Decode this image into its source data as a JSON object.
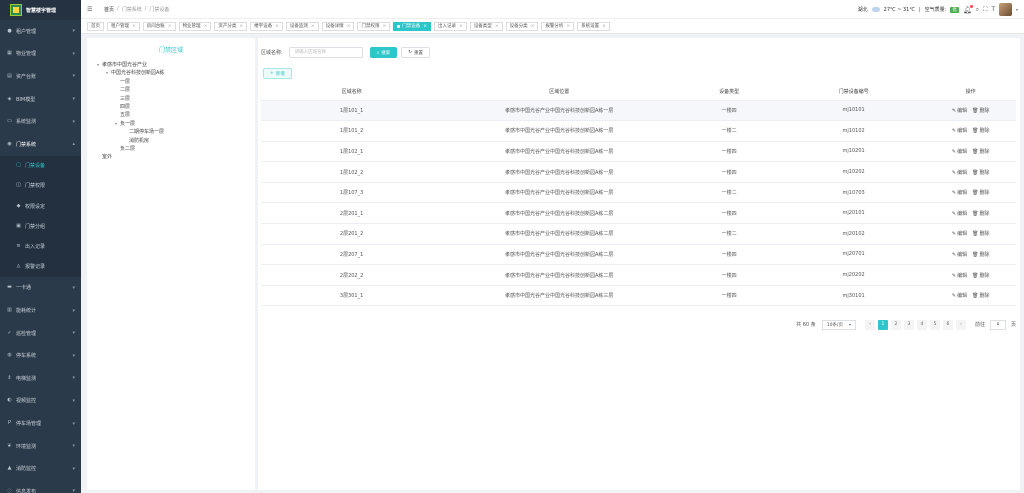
{
  "app": {
    "title": "智慧楼宇管理"
  },
  "sidebar": {
    "items": [
      {
        "label": "租户管理",
        "icon": "user-icon"
      },
      {
        "label": "物业管理",
        "icon": "building-icon"
      },
      {
        "label": "资产台账",
        "icon": "grid-icon"
      },
      {
        "label": "BIM模型",
        "icon": "cube-icon"
      },
      {
        "label": "系统监测",
        "icon": "monitor-icon"
      },
      {
        "label": "门禁系统",
        "icon": "lock-icon",
        "open": true
      }
    ],
    "sub_items": [
      {
        "label": "门禁设备",
        "icon": "door-icon",
        "active": true
      },
      {
        "label": "门禁权限",
        "icon": "key-icon"
      },
      {
        "label": "权限设定",
        "icon": "shield-icon"
      },
      {
        "label": "门禁分组",
        "icon": "folder-icon"
      },
      {
        "label": "出入记录",
        "icon": "list-icon"
      },
      {
        "label": "报警记录",
        "icon": "alarm-icon"
      }
    ],
    "items_after": [
      {
        "label": "一卡通",
        "icon": "card-icon"
      },
      {
        "label": "能耗统计",
        "icon": "chart-icon"
      },
      {
        "label": "巡检管理",
        "icon": "check-icon"
      },
      {
        "label": "停车系统",
        "icon": "car-icon"
      },
      {
        "label": "电梯监测",
        "icon": "elevator-icon"
      },
      {
        "label": "视频监控",
        "icon": "camera-icon"
      },
      {
        "label": "停车场管理",
        "icon": "parking-icon"
      },
      {
        "label": "环境监测",
        "icon": "leaf-icon"
      },
      {
        "label": "消防监控",
        "icon": "fire-icon"
      },
      {
        "label": "信息发布",
        "icon": "message-icon"
      }
    ]
  },
  "header": {
    "breadcrumb": [
      "首页",
      "门禁系统",
      "门禁设备"
    ],
    "location": "湖北",
    "temperature": "27℃ ~ 31℃",
    "air_label": "空气质量:",
    "air_value": "优"
  },
  "tags": [
    {
      "label": "首页"
    },
    {
      "label": "租户管理"
    },
    {
      "label": "房间台账"
    },
    {
      "label": "物业管理"
    },
    {
      "label": "资产分类"
    },
    {
      "label": "楼宇设备"
    },
    {
      "label": "设备监测"
    },
    {
      "label": "设备详情"
    },
    {
      "label": "门禁权限"
    },
    {
      "label": "门禁设备",
      "active": true
    },
    {
      "label": "出入记录"
    },
    {
      "label": "设备类型"
    },
    {
      "label": "设备分类"
    },
    {
      "label": "报警分析"
    },
    {
      "label": "系统设置"
    }
  ],
  "tree": {
    "title": "门禁区域",
    "nodes": [
      {
        "label": "孝感市中国光谷产业",
        "level": 0,
        "toggle": "▾"
      },
      {
        "label": "中国光谷科技创新园A栋",
        "level": 1,
        "toggle": "▾"
      },
      {
        "label": "一层",
        "level": 2,
        "toggle": ""
      },
      {
        "label": "二层",
        "level": 2,
        "toggle": ""
      },
      {
        "label": "三层",
        "level": 2,
        "toggle": ""
      },
      {
        "label": "四层",
        "level": 2,
        "toggle": ""
      },
      {
        "label": "五层",
        "level": 2,
        "toggle": ""
      },
      {
        "label": "负一层",
        "level": 2,
        "toggle": "▾"
      },
      {
        "label": "二期停车场一层",
        "level": 3,
        "toggle": ""
      },
      {
        "label": "消防机房",
        "level": 3,
        "toggle": ""
      },
      {
        "label": "负二层",
        "level": 2,
        "toggle": ""
      },
      {
        "label": "室外",
        "level": 0,
        "toggle": ""
      }
    ]
  },
  "search": {
    "label": "区域名称:",
    "placeholder": "请输入区域名称",
    "search_label": "搜索",
    "reset_label": "重置",
    "add_label": "新增"
  },
  "table": {
    "columns": [
      "区域名称",
      "区域位置",
      "设备类型",
      "门禁设备编号",
      "操作"
    ],
    "edit_label": "编辑",
    "delete_label": "删除",
    "rows": [
      [
        "1层101_1",
        "孝感市中国光谷产业中国光谷科技创新园A栋一层",
        "一楼四",
        "mj10101"
      ],
      [
        "1层101_2",
        "孝感市中国光谷产业中国光谷科技创新园A栋一层",
        "一楼二",
        "mj10102"
      ],
      [
        "1层102_1",
        "孝感市中国光谷产业中国光谷科技创新园A栋一层",
        "一楼四",
        "mj10201"
      ],
      [
        "1层102_2",
        "孝感市中国光谷产业中国光谷科技创新园A栋一层",
        "一楼四",
        "mj10202"
      ],
      [
        "1层107_3",
        "孝感市中国光谷产业中国光谷科技创新园A栋一层",
        "一楼二",
        "mj10703"
      ],
      [
        "2层201_1",
        "孝感市中国光谷产业中国光谷科技创新园A栋二层",
        "一楼四",
        "mj20101"
      ],
      [
        "2层201_2",
        "孝感市中国光谷产业中国光谷科技创新园A栋二层",
        "一楼二",
        "mj20102"
      ],
      [
        "2层207_1",
        "孝感市中国光谷产业中国光谷科技创新园A栋二层",
        "一楼四",
        "mj20701"
      ],
      [
        "2层202_2",
        "孝感市中国光谷产业中国光谷科技创新园A栋二层",
        "一楼四",
        "mj20202"
      ],
      [
        "3层301_1",
        "孝感市中国光谷产业中国光谷科技创新园A栋三层",
        "一楼四",
        "mj30101"
      ]
    ]
  },
  "pagination": {
    "total_label": "共 60 条",
    "page_size": "10条/页",
    "pages": [
      "1",
      "2",
      "3",
      "4",
      "5",
      "6"
    ],
    "current": "1",
    "goto_label": "前往",
    "goto_value": "1",
    "page_unit": "页"
  }
}
